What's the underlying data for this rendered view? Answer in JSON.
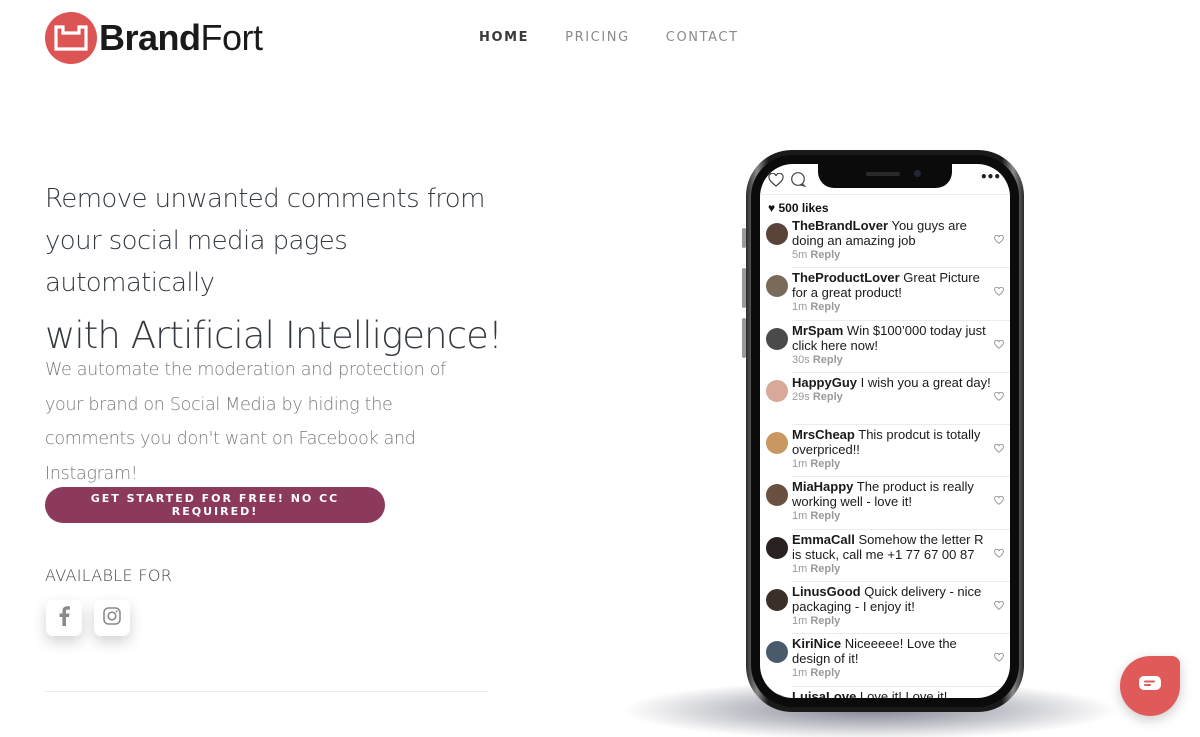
{
  "brand": {
    "name_bold": "Brand",
    "name_light": "Fort",
    "color": "#dd5454"
  },
  "nav": {
    "items": [
      {
        "label": "HOME",
        "active": true
      },
      {
        "label": "PRICING",
        "active": false
      },
      {
        "label": "CONTACT",
        "active": false
      }
    ]
  },
  "hero": {
    "headline_line1": "Remove unwanted comments from",
    "headline_line2": "your social media pages automatically",
    "headline_line3": "with Artificial Intelligence!",
    "description": "We automate the moderation and protection of your brand on Social Media by hiding the comments you don't want on Facebook and Instagram!",
    "cta_label": "GET STARTED FOR FREE! NO CC REQUIRED!",
    "cta_color": "#8c3a5b",
    "available_for": "AVAILABLE FOR",
    "platforms": [
      {
        "name": "Facebook",
        "icon": "facebook-icon"
      },
      {
        "name": "Instagram",
        "icon": "instagram-icon"
      }
    ]
  },
  "phone": {
    "likes": "500 likes",
    "comments": [
      {
        "user": "TheBrandLover",
        "text": "You guys are doing an amazing job",
        "time": "5m",
        "reply": "Reply",
        "avatar_color": "#5a4338"
      },
      {
        "user": "TheProductLover",
        "text": "Great Picture for a great product!",
        "time": "1m",
        "reply": "Reply",
        "avatar_color": "#7a6a5a"
      },
      {
        "user": "MrSpam",
        "text": "Win $100’000 today just click here now!",
        "time": "30s",
        "reply": "Reply",
        "avatar_color": "#4a4a4a"
      },
      {
        "user": "HappyGuy",
        "text": "I wish you a great day!",
        "time": "29s",
        "reply": "Reply",
        "avatar_color": "#d8a898"
      },
      {
        "user": "MrsCheap",
        "text": "This prodcut is totally overpriced!!",
        "time": "1m",
        "reply": "Reply",
        "avatar_color": "#c89860"
      },
      {
        "user": "MiaHappy",
        "text": "The product is really working well - love it!",
        "time": "1m",
        "reply": "Reply",
        "avatar_color": "#6a5040"
      },
      {
        "user": "EmmaCall",
        "text": "Somehow the letter R is stuck, call me +1 77 67 00 87",
        "time": "1m",
        "reply": "Reply",
        "avatar_color": "#2a2220"
      },
      {
        "user": "LinusGood",
        "text": "Quick delivery - nice packaging - I enjoy it!",
        "time": "1m",
        "reply": "Reply",
        "avatar_color": "#3a3028"
      },
      {
        "user": "KiriNice",
        "text": "Niceeeee! Love the design of it!",
        "time": "1m",
        "reply": "Reply",
        "avatar_color": "#4a5a6a"
      },
      {
        "user": "LuisaLove",
        "text": "Love it! Love it!",
        "time": "",
        "reply": "",
        "avatar_color": "#b0a8a0"
      }
    ]
  },
  "chat_widget": {
    "icon": "chat-icon",
    "color": "#e05a5a"
  }
}
